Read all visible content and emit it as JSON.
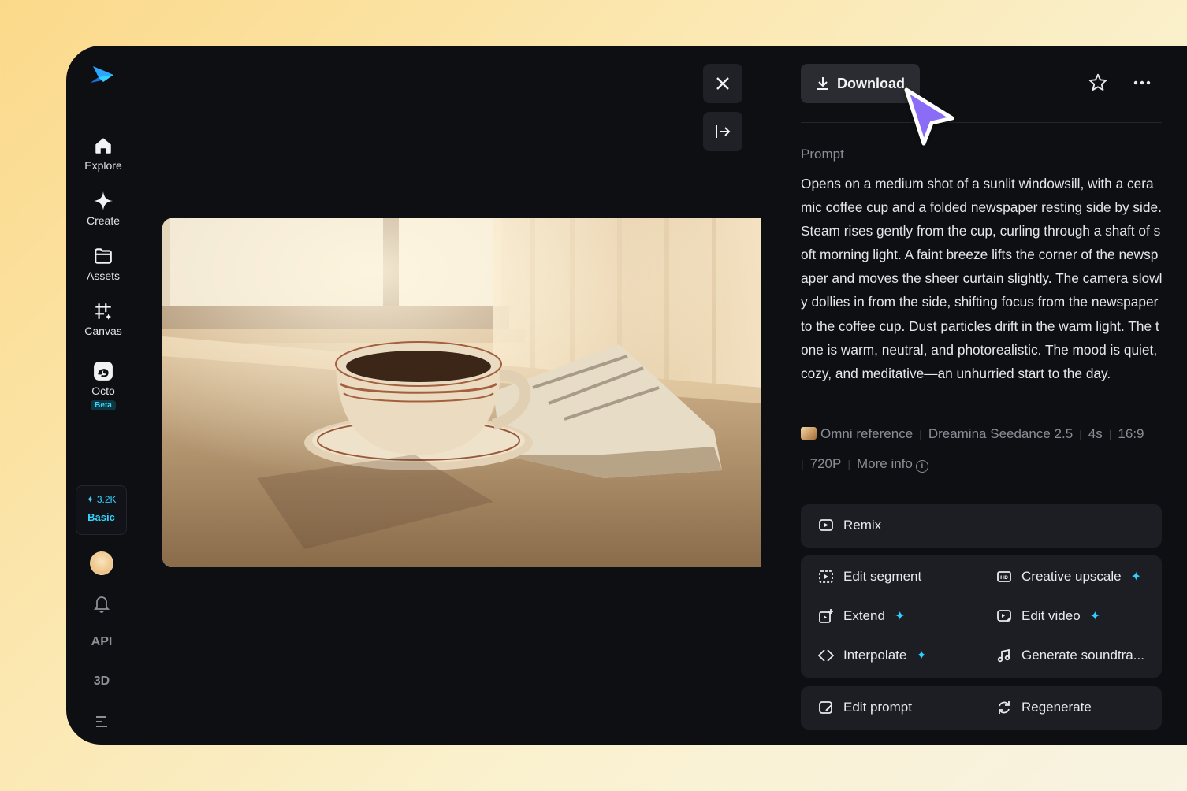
{
  "sidebar": {
    "items": [
      {
        "label": "Explore",
        "icon": "home-icon"
      },
      {
        "label": "Create",
        "icon": "sparkle-icon"
      },
      {
        "label": "Assets",
        "icon": "folder-icon"
      },
      {
        "label": "Canvas",
        "icon": "canvas-icon"
      },
      {
        "label": "Octo",
        "icon": "octo-icon",
        "badge": "Beta"
      }
    ],
    "credits": {
      "amount": "3.2K",
      "plan": "Basic"
    },
    "bottom": {
      "api_label": "API",
      "three_d_label": "3D"
    }
  },
  "toolbar": {
    "download_label": "Download"
  },
  "prompt": {
    "label": "Prompt",
    "text": "Opens on a medium shot of a sunlit windowsill, with a ceramic coffee cup and a folded newspaper resting side by side. Steam rises gently from the cup, curling through a shaft of soft morning light. A faint breeze lifts the corner of the newspaper and moves the sheer curtain slightly. The camera slowly dollies in from the side, shifting focus from the newspaper to the coffee cup. Dust particles drift in the warm light. The tone is warm, neutral, and photorealistic. The mood is quiet, cozy, and meditative—an unhurried start to the day."
  },
  "meta": {
    "reference": "Omni reference",
    "model": "Dreamina Seedance 2.5",
    "duration": "4s",
    "ratio": "16:9",
    "resolution": "720P",
    "more_info": "More info"
  },
  "actions": {
    "remix": "Remix",
    "edit_segment": "Edit segment",
    "creative_upscale": "Creative upscale",
    "extend": "Extend",
    "edit_video": "Edit video",
    "interpolate": "Interpolate",
    "generate_soundtrack": "Generate soundtra...",
    "edit_prompt": "Edit prompt",
    "regenerate": "Regenerate"
  },
  "colors": {
    "accent": "#2fd0ff",
    "cursor": "#8b6cf6",
    "panel": "#1c1e23"
  }
}
